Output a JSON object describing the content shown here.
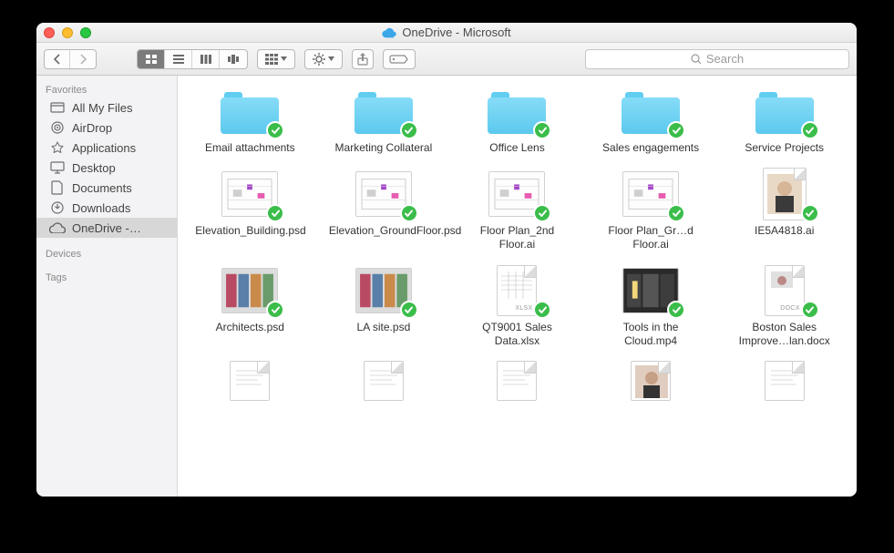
{
  "window": {
    "title": "OneDrive - Microsoft"
  },
  "toolbar": {
    "search_placeholder": "Search"
  },
  "sidebar": {
    "sections": {
      "favorites": "Favorites",
      "devices": "Devices",
      "tags": "Tags"
    },
    "items": [
      {
        "label": "All My Files",
        "icon": "all-my-files"
      },
      {
        "label": "AirDrop",
        "icon": "airdrop"
      },
      {
        "label": "Applications",
        "icon": "applications"
      },
      {
        "label": "Desktop",
        "icon": "desktop"
      },
      {
        "label": "Documents",
        "icon": "documents"
      },
      {
        "label": "Downloads",
        "icon": "downloads"
      },
      {
        "label": "OneDrive -…",
        "icon": "cloud",
        "selected": true
      }
    ]
  },
  "files": [
    {
      "name": "Email attachments",
      "type": "folder"
    },
    {
      "name": "Marketing Collateral",
      "type": "folder"
    },
    {
      "name": "Office Lens",
      "type": "folder"
    },
    {
      "name": "Sales engagements",
      "type": "folder"
    },
    {
      "name": "Service Projects",
      "type": "folder"
    },
    {
      "name": "Elevation_Building.psd",
      "type": "psd"
    },
    {
      "name": "Elevation_GroundFloor.psd",
      "type": "psd"
    },
    {
      "name": "Floor Plan_2nd Floor.ai",
      "type": "ai"
    },
    {
      "name": "Floor Plan_Gr…d Floor.ai",
      "type": "ai"
    },
    {
      "name": "IE5A4818.ai",
      "type": "photo"
    },
    {
      "name": "Architects.psd",
      "type": "psd-img"
    },
    {
      "name": "LA site.psd",
      "type": "psd-img"
    },
    {
      "name": "QT9001 Sales Data.xlsx",
      "type": "xlsx"
    },
    {
      "name": "Tools in the Cloud.mp4",
      "type": "video"
    },
    {
      "name": "Boston Sales Improve…lan.docx",
      "type": "docx"
    }
  ],
  "partial_files": [
    {
      "type": "page"
    },
    {
      "type": "page"
    },
    {
      "type": "page"
    },
    {
      "type": "photo-partial"
    },
    {
      "type": "page"
    }
  ],
  "colors": {
    "folder": "#6bd3f3",
    "sync_badge": "#3bbd4a"
  }
}
